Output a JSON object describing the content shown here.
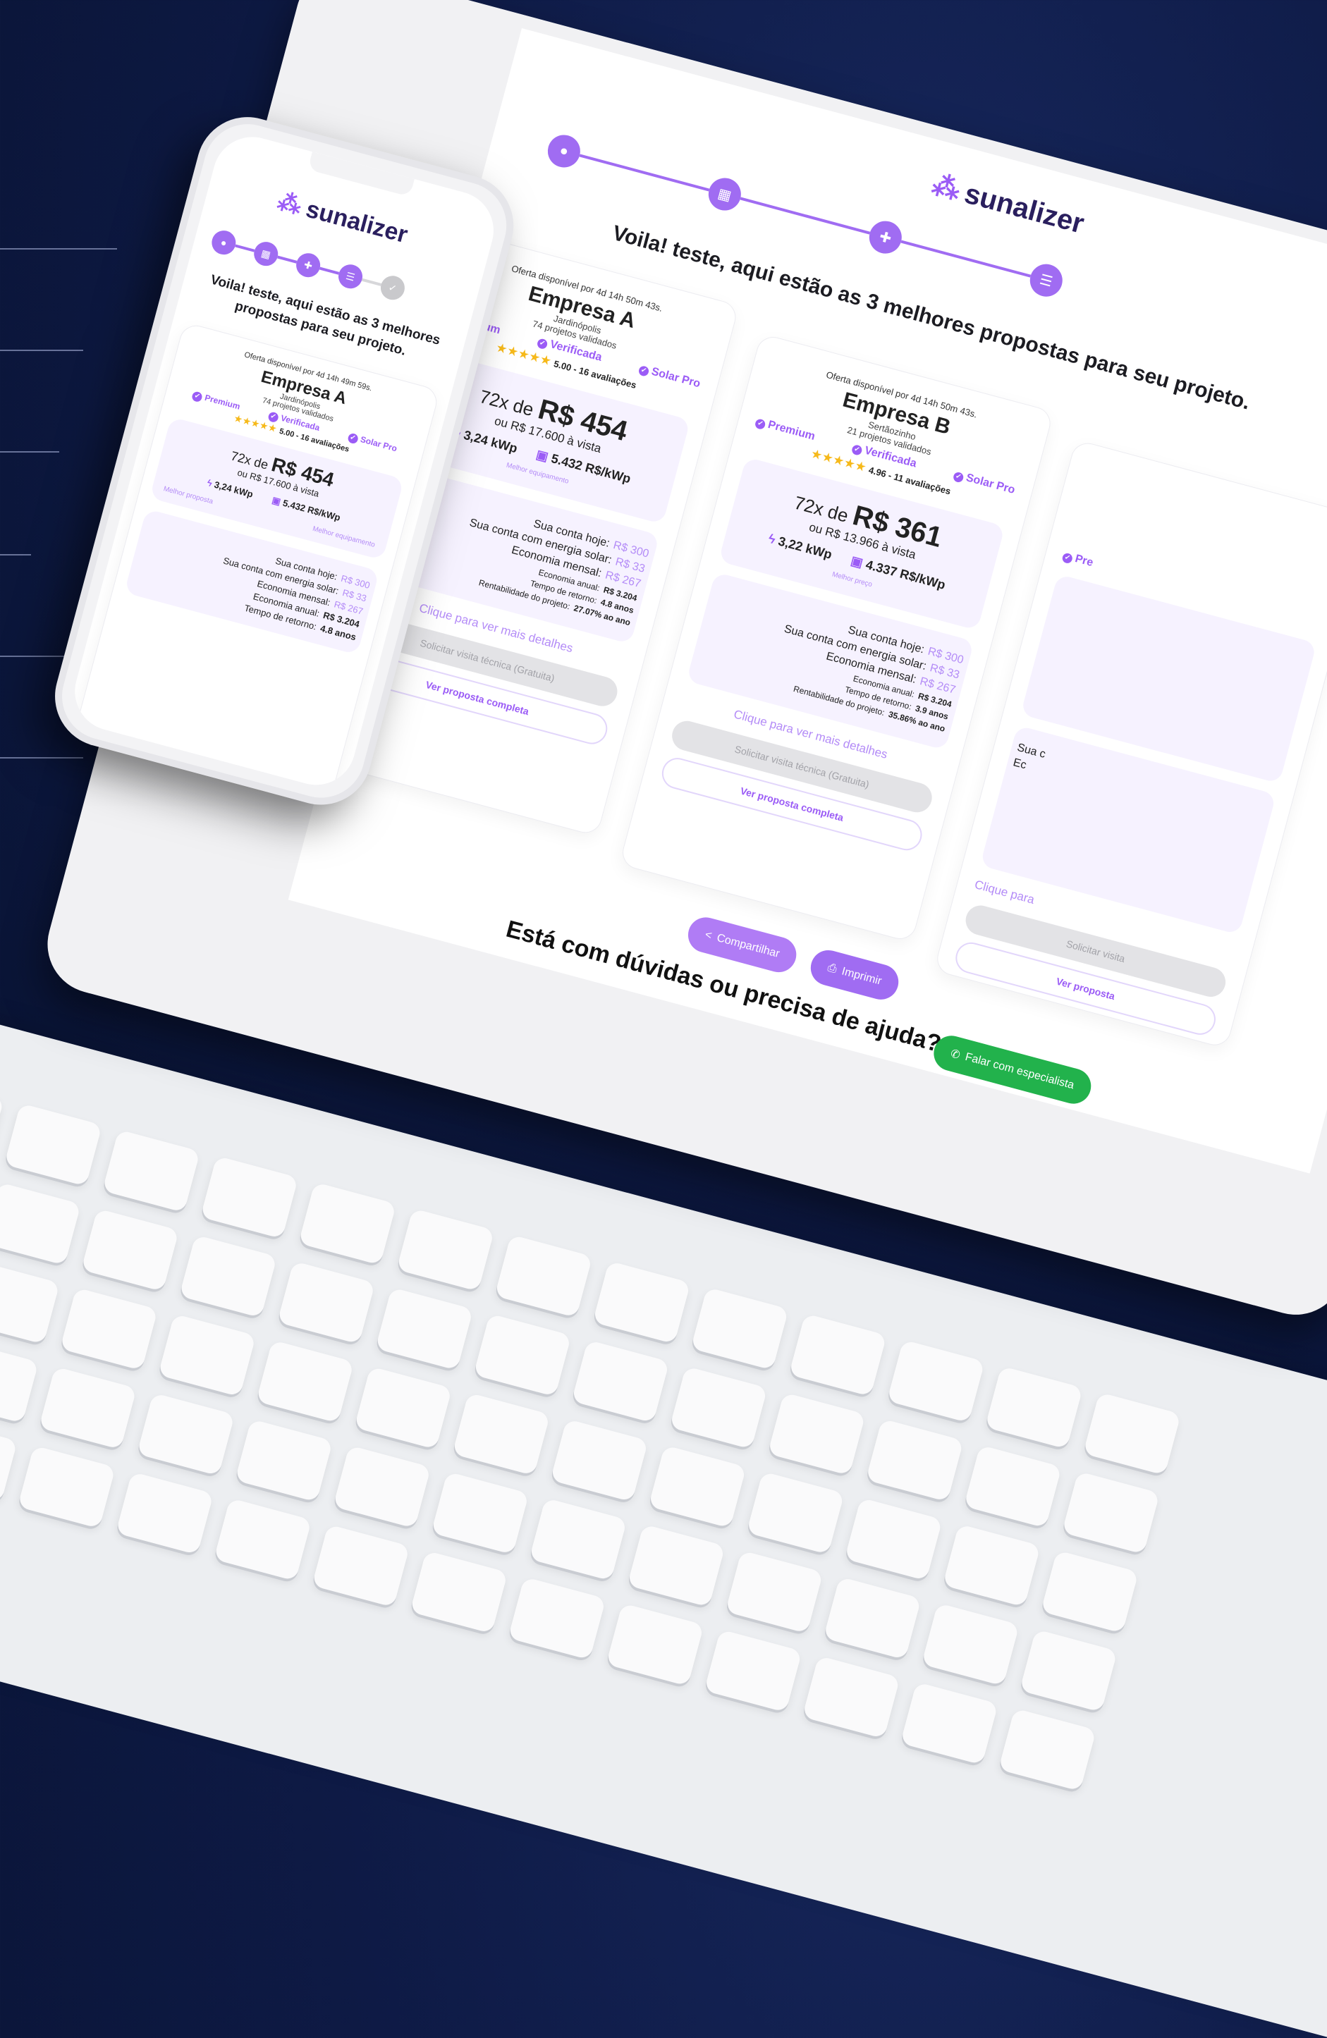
{
  "brand": {
    "name": "sunalizer",
    "accent": "#9b5cf6"
  },
  "headline": "Voila! teste, aqui estão as 3 melhores propostas para seu projeto.",
  "phone_headline": {
    "line1": "Voila! teste, aqui estão as 3 melhores",
    "line2": "propostas para seu projeto."
  },
  "steps": [
    "user-icon",
    "grid-icon",
    "user-add-icon",
    "list-check-icon",
    "check-icon"
  ],
  "proposals": [
    {
      "offer": "Oferta disponível por 4d 14h 50m 43s.",
      "company": "Empresa A",
      "city": "Jardinópolis",
      "validated": "74 projetos validados",
      "badges": {
        "premium": "Premium",
        "verified": "Verificada",
        "solar": "Solar Pro"
      },
      "stars": "★★★★★",
      "rating": "5.00 - 16 avaliações",
      "installments": "72x de",
      "price": "R$ 454",
      "cash": "ou R$ 17.600 à vista",
      "power": "3,24 kWp",
      "price_per_kwp": "5.432 R$/kWp",
      "tag_left": "Melhor proposta",
      "tag_right": "Melhor equipamento",
      "bill_today_label": "Sua conta hoje:",
      "bill_today": "R$ 300",
      "bill_solar_label": "Sua conta com energia solar:",
      "bill_solar": "R$ 33",
      "monthly_label": "Economia mensal:",
      "monthly": "R$ 267",
      "annual_label": "Economia anual:",
      "annual": "R$ 3.204",
      "payback_label": "Tempo de retorno:",
      "payback": "4.8 anos",
      "return_label": "Rentabilidade do projeto:",
      "return": "27.07% ao ano"
    },
    {
      "offer": "Oferta disponível por 4d 14h 50m 43s.",
      "company": "Empresa B",
      "city": "Sertãozinho",
      "validated": "21 projetos validados",
      "badges": {
        "premium": "Premium",
        "verified": "Verificada",
        "solar": "Solar Pro"
      },
      "stars": "★★★★★",
      "rating": "4.96 - 11 avaliações",
      "installments": "72x de",
      "price": "R$ 361",
      "cash": "ou R$ 13.966 à vista",
      "power": "3,22 kWp",
      "price_per_kwp": "4.337 R$/kWp",
      "tag_left": "Melhor preço",
      "tag_right": "",
      "bill_today_label": "Sua conta hoje:",
      "bill_today": "R$ 300",
      "bill_solar_label": "Sua conta com energia solar:",
      "bill_solar": "R$ 33",
      "monthly_label": "Economia mensal:",
      "monthly": "R$ 267",
      "annual_label": "Economia anual:",
      "annual": "R$ 3.204",
      "payback_label": "Tempo de retorno:",
      "payback": "3.9 anos",
      "return_label": "Rentabilidade do projeto:",
      "return": "35.86% ao ano"
    }
  ],
  "phone_offer": "Oferta disponível por 4d 14h 49m 59s.",
  "details_link": "Clique para ver mais detalhes",
  "visit_button": "Solicitar visita técnica (Gratuita)",
  "full_button": "Ver proposta completa",
  "share_button": "Compartilhar",
  "print_button": "Imprimir",
  "help_text": "Está com dúvidas ou precisa de ajuda?",
  "specialist_button": "Falar com especialista",
  "third_card": {
    "premium": "Pre",
    "bill": "Sua c",
    "econ": "Ec",
    "details": "Clique para",
    "visit": "Solicitar visita",
    "full": "Ver proposta"
  }
}
